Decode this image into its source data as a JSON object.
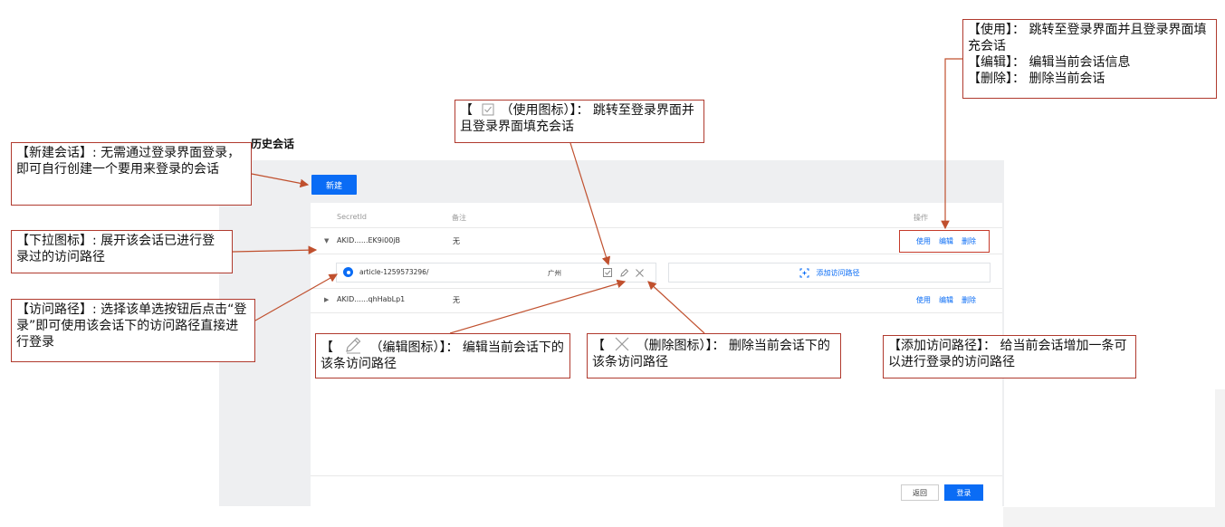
{
  "page": {
    "title": "历史会话",
    "new_button": "新建",
    "columns": {
      "secret_id": "SecretId",
      "remark": "备注",
      "action": "操作"
    },
    "rows": [
      {
        "secret_id": "AKID......EK9i00jB",
        "remark": "无",
        "ops": [
          "使用",
          "编辑",
          "删除"
        ]
      },
      {
        "secret_id": "AKID......qhHabLp1",
        "remark": "无",
        "ops": [
          "使用",
          "编辑",
          "删除"
        ]
      }
    ],
    "path": {
      "name": "article-1259573296/",
      "region": "广州"
    },
    "add_path": "添加访问路径",
    "back_button": "返回",
    "login_button": "登录"
  },
  "annotations": {
    "new_session": "【新建会话】: 无需通过登录界面登录，即可自行创建一个要用来登录的会话",
    "dropdown": "【下拉图标】: 展开该会话已进行登录过的访问路径",
    "access_path": "【访问路径】: 选择该单选按钮后点击“登录”即可使用该会话下的访问路径直接进行登录",
    "use_icon_pre": "【",
    "use_icon_post": "（使用图标）】： 跳转至登录界面并且登录界面填充会话",
    "edit_icon_pre": "【",
    "edit_icon_post": "（编辑图标）】： 编辑当前会话下的该条访问路径",
    "delete_icon_pre": "【",
    "delete_icon_post": "（删除图标）】： 删除当前会话下的该条访问路径",
    "add_path": "【添加访问路径】： 给当前会话增加一条可以进行登录的访问路径",
    "ops_line1": "【使用】： 跳转至登录界面并且登录界面填充会话",
    "ops_line2": "【编辑】： 编辑当前会话信息",
    "ops_line3": "【删除】： 删除当前会话"
  },
  "colors": {
    "accent": "#0a6cf5",
    "annotation_border": "#b03a2e",
    "arrow": "#c0502e",
    "panel_bg": "#eeeff1"
  }
}
